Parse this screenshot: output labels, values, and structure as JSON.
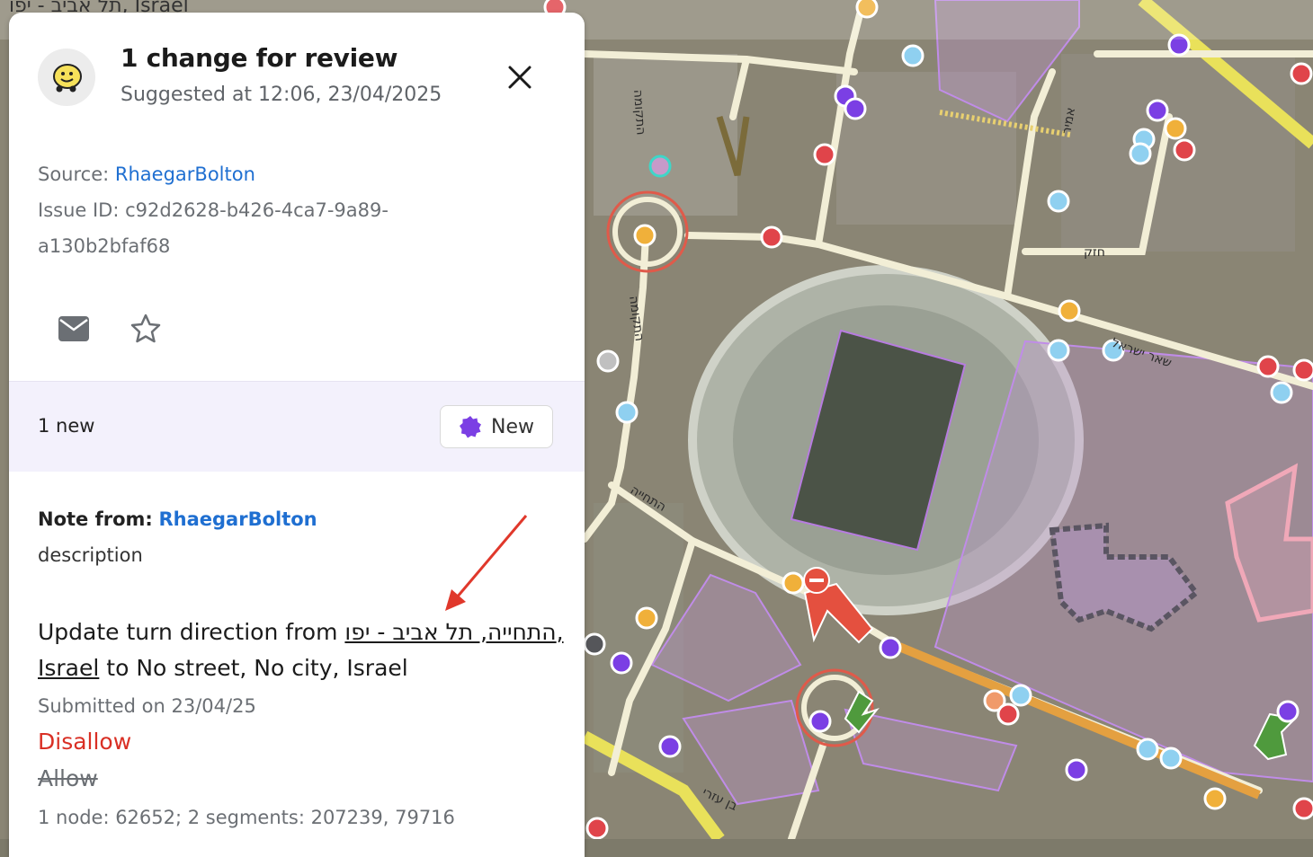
{
  "map": {
    "city_label": "תל אביב - יפו, Israel",
    "street_labels": [
      "התקומה",
      "התקומה",
      "התחייה",
      "שאר ישראל",
      "חזק",
      "אמיר",
      "בן עזרי"
    ]
  },
  "panel": {
    "title": "1 change for review",
    "subtitle": "Suggested at 12:06, 23/04/2025",
    "source_label": "Source: ",
    "source_user": "RhaegarBolton",
    "issue_label": "Issue ID: ",
    "issue_id_line1": "c92d2628-b426-4ca7-9a89-",
    "issue_id_line2": "a130b2bfaf68",
    "new_count": "1 new",
    "new_button": "New",
    "note_from_label": "Note from:",
    "note_from_user": "RhaegarBolton",
    "description": "description",
    "change_prefix": "Update turn direction from ",
    "change_from_place": "התחייה, תל אביב - יפו, Israel",
    "change_suffix": " to No street, No city, Israel",
    "submitted": "Submitted on 23/04/25",
    "disallow": "Disallow",
    "allow": "Allow",
    "nodes": "1 node: 62652; 2 segments: 207239, 79716"
  },
  "icons": {
    "avatar": "waze-logo-icon",
    "close": "close-icon",
    "mail": "mail-icon",
    "star": "star-icon",
    "new_badge": "new-badge-icon"
  },
  "colors": {
    "link": "#1f6fd1",
    "disallow": "#d93025",
    "new_badge": "#7b3fe4",
    "newbar_bg": "#f3f1fc"
  }
}
